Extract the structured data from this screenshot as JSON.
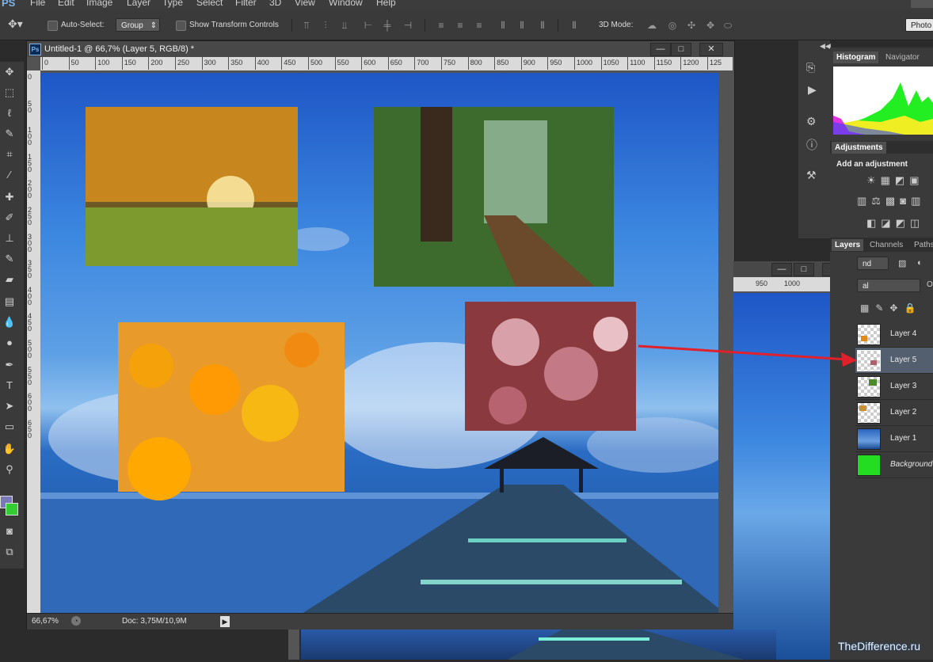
{
  "app": {
    "logo": "PS"
  },
  "menu": [
    "File",
    "Edit",
    "Image",
    "Layer",
    "Type",
    "Select",
    "Filter",
    "3D",
    "View",
    "Window",
    "Help"
  ],
  "options": {
    "auto_select_label": "Auto-Select:",
    "auto_select_value": "Group",
    "show_transform_label": "Show Transform Controls",
    "mode_3d_label": "3D Mode:",
    "workspace_button": "Photo"
  },
  "document": {
    "title": "Untitled-1 @ 66,7% (Layer 5, RGB/8) *",
    "ruler_h": [
      "0",
      "50",
      "100",
      "150",
      "200",
      "250",
      "300",
      "350",
      "400",
      "450",
      "500",
      "550",
      "600",
      "650",
      "700",
      "750",
      "800",
      "850",
      "900",
      "950",
      "1000",
      "1050",
      "1100",
      "1150",
      "1200",
      "125"
    ],
    "ruler_v": [
      "0",
      "50",
      "100",
      "150",
      "200",
      "250",
      "300",
      "350",
      "400",
      "450",
      "500",
      "550",
      "600",
      "650"
    ],
    "zoom": "66,67%",
    "doc_info": "Doc: 3,75M/10,9M"
  },
  "second_window": {
    "ruler_h": [
      "950",
      "1000"
    ],
    "blend_mode": "al"
  },
  "panels": {
    "histogram_tab": "Histogram",
    "navigator_tab": "Navigator",
    "adjustments_tab": "Adjustments",
    "add_adjustment": "Add an adjustment",
    "layers_tab": "Layers",
    "channels_tab": "Channels",
    "paths_tab": "Paths",
    "kind_value": "nd",
    "opacity_label": "O"
  },
  "layers": [
    {
      "name": "Layer 4",
      "selected": false,
      "thumb_color": "#e08a1e"
    },
    {
      "name": "Layer 5",
      "selected": true,
      "thumb_color": "#b0606a"
    },
    {
      "name": "Layer 3",
      "selected": false,
      "thumb_color": "#4a8a2a"
    },
    {
      "name": "Layer 2",
      "selected": false,
      "thumb_color": "#c89030"
    },
    {
      "name": "Layer 1",
      "selected": false,
      "thumb_color": "#2a64c0"
    },
    {
      "name": "Background",
      "selected": false,
      "thumb_color": "#22dd22"
    }
  ],
  "colors": {
    "foreground": "#7b78b8",
    "background": "#33cc33",
    "arrow": "#e0202a"
  },
  "watermark": "TheDifference.ru"
}
